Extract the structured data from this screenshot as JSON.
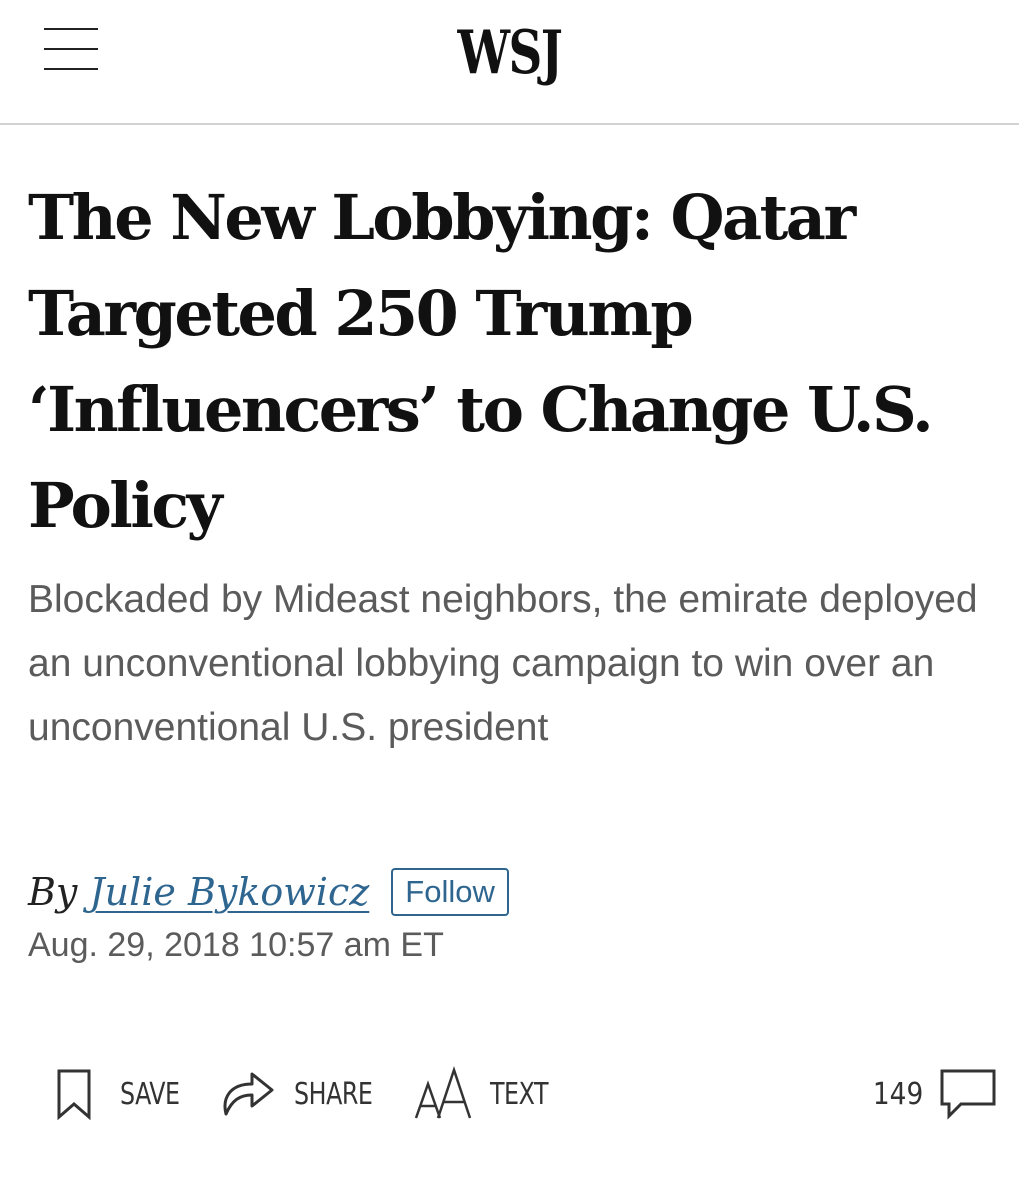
{
  "header": {
    "logo": "WSJ",
    "menu_icon": "hamburger-menu-icon"
  },
  "article": {
    "headline": "The New Lobbying: Qatar Targeted 250 Trump ‘Influencers’ to Change U.S. Policy",
    "dek": "Blockaded by Mideast neighbors, the emirate deployed an unconventional lobbying campaign to win over an unconventional U.S. president",
    "byline_prefix": "By",
    "author": "Julie Bykowicz",
    "follow_label": "Follow",
    "timestamp": "Aug. 29, 2018 10:57 am ET"
  },
  "toolbar": {
    "save_label": "SAVE",
    "save_icon": "bookmark-icon",
    "share_label": "SHARE",
    "share_icon": "share-arrow-icon",
    "text_label": "TEXT",
    "text_icon": "text-size-icon",
    "comments_count": "149",
    "comments_icon": "comment-bubble-icon"
  },
  "colors": {
    "link": "#2f6690",
    "headline": "#111111",
    "dek": "#5b5b5b",
    "divider": "#d2d2d2"
  }
}
